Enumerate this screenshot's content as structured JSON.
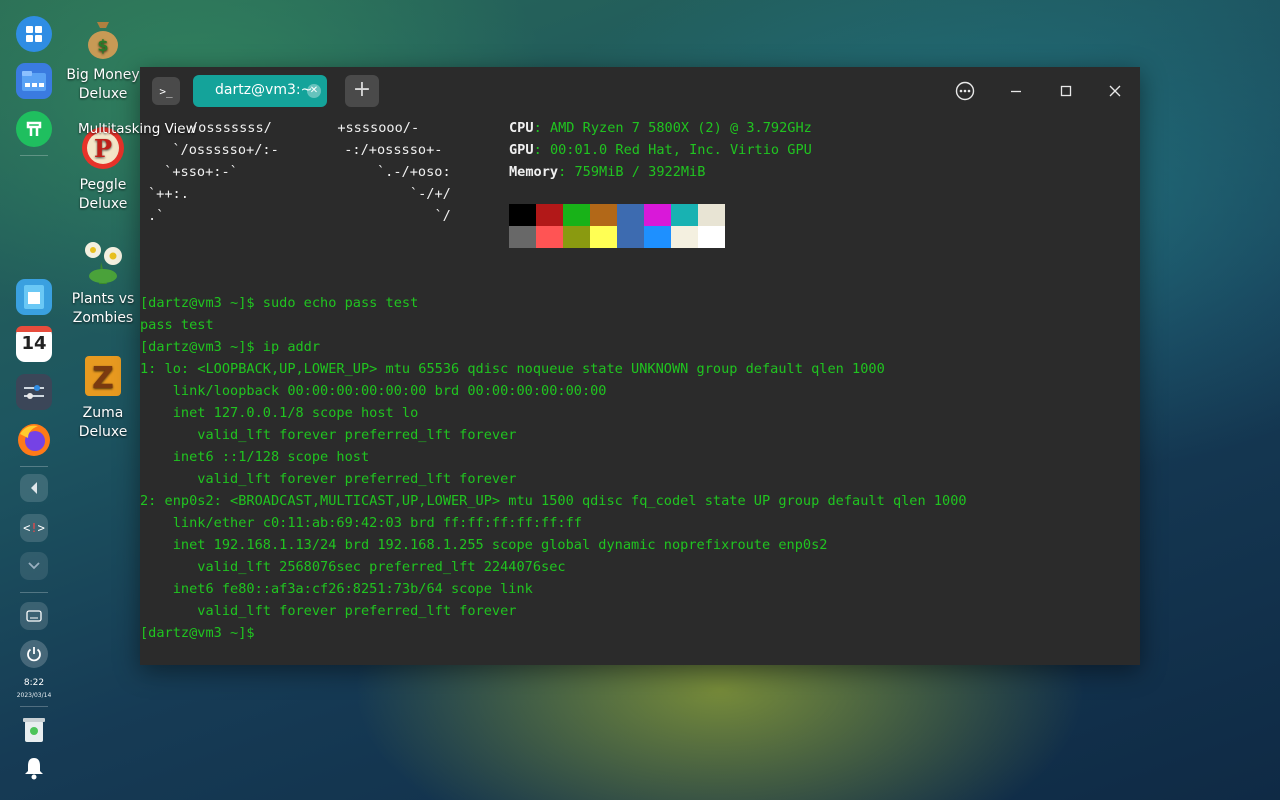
{
  "dock": {
    "clock_time": "8:22",
    "clock_date": "2023/03/14",
    "calendar_day": "14"
  },
  "desktop": {
    "icons": [
      {
        "label_line1": "Big Money",
        "label_line2": "Deluxe"
      },
      {
        "label_line1": "Peggle",
        "label_line2": "Deluxe"
      },
      {
        "label_line1": "Plants vs",
        "label_line2": "Zombies"
      },
      {
        "label_line1": "Zuma",
        "label_line2": "Deluxe"
      }
    ],
    "tooltip": "Multitasking View"
  },
  "terminal": {
    "tab_title": "dartz@vm3:~",
    "app_icon": ">_",
    "new_tab_label": "+",
    "logo_lines": [
      "/osssssss/        +ssssooo/-",
      "  `/ossssso+/:-        -:/+osssso+-",
      " `+sso+:-`                 `.-/+oso:",
      "`++:.                           `-/+/",
      ".`                                 `/"
    ],
    "info": [
      {
        "key": "CPU",
        "value": "AMD Ryzen 7 5800X (2) @ 3.792GHz"
      },
      {
        "key": "GPU",
        "value": "00:01.0 Red Hat, Inc. Virtio GPU"
      },
      {
        "key": "Memory",
        "value": "759MiB / 3922MiB"
      }
    ],
    "palette_top": [
      "#000000",
      "#b21818",
      "#18b218",
      "#b26818",
      "#3d6bb0",
      "#d918d9",
      "#18b2b2",
      "#e8e4d4"
    ],
    "palette_bottom": [
      "#686868",
      "#ff5454",
      "#8a9a10",
      "#ffff54",
      "#3d6bb0",
      "#1e90ff",
      "#f4f0e0",
      "#ffffff"
    ],
    "output_lines": [
      "[dartz@vm3 ~]$ sudo echo pass test",
      "pass test",
      "[dartz@vm3 ~]$ ip addr",
      "1: lo: <LOOPBACK,UP,LOWER_UP> mtu 65536 qdisc noqueue state UNKNOWN group default qlen 1000",
      "    link/loopback 00:00:00:00:00:00 brd 00:00:00:00:00:00",
      "    inet 127.0.0.1/8 scope host lo",
      "       valid_lft forever preferred_lft forever",
      "    inet6 ::1/128 scope host",
      "       valid_lft forever preferred_lft forever",
      "2: enp0s2: <BROADCAST,MULTICAST,UP,LOWER_UP> mtu 1500 qdisc fq_codel state UP group default qlen 1000",
      "    link/ether c0:11:ab:69:42:03 brd ff:ff:ff:ff:ff:ff",
      "    inet 192.168.1.13/24 brd 192.168.1.255 scope global dynamic noprefixroute enp0s2",
      "       valid_lft 2568076sec preferred_lft 2244076sec",
      "    inet6 fe80::af3a:cf26:8251:73b/64 scope link",
      "       valid_lft forever preferred_lft forever",
      "[dartz@vm3 ~]$"
    ]
  }
}
